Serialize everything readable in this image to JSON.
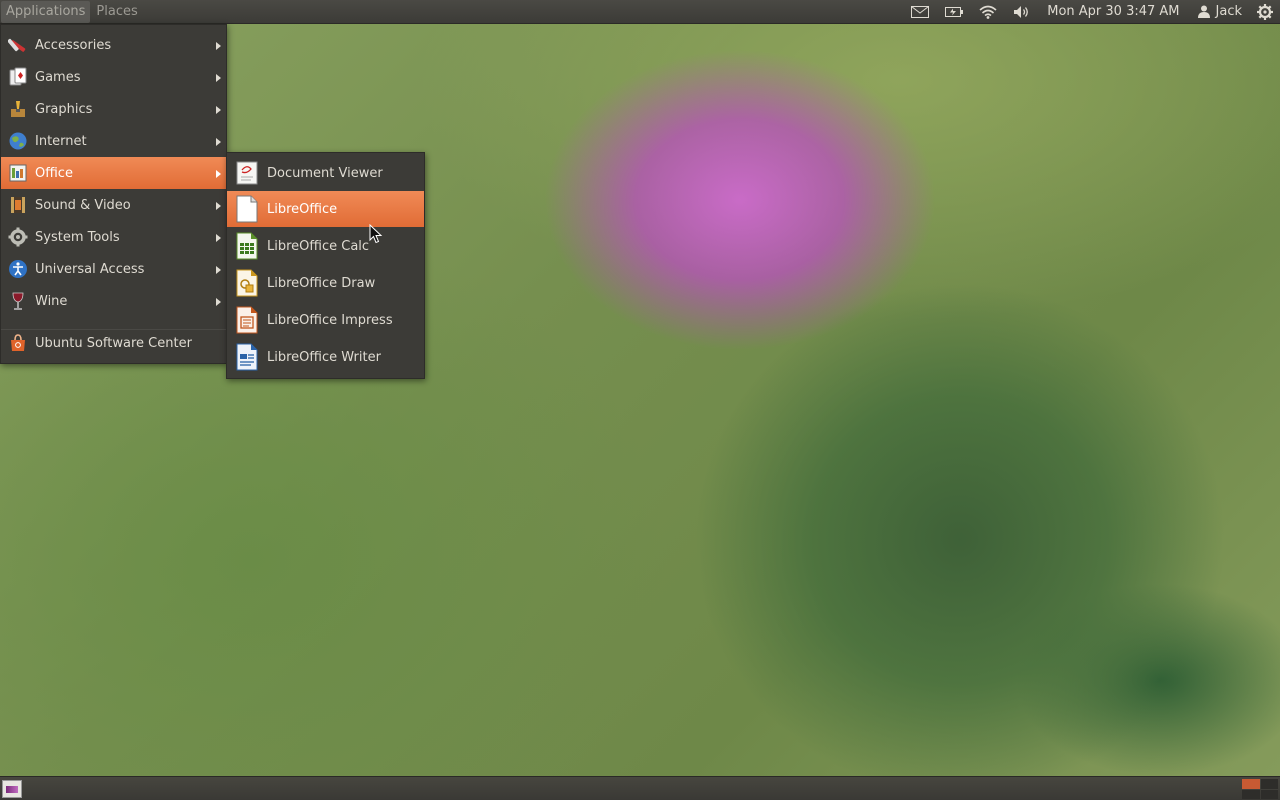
{
  "top_panel": {
    "menus": [
      {
        "label": "Applications",
        "active": true
      },
      {
        "label": "Places",
        "active": false
      }
    ],
    "tray_icons": [
      "mail-icon",
      "battery-icon",
      "wifi-icon",
      "volume-icon"
    ],
    "clock": "Mon Apr 30  3:47 AM",
    "user": "Jack",
    "session_icon": "gear-icon"
  },
  "applications_menu": {
    "items": [
      {
        "label": "Accessories",
        "icon": "accessories-icon",
        "has_submenu": true
      },
      {
        "label": "Games",
        "icon": "games-icon",
        "has_submenu": true
      },
      {
        "label": "Graphics",
        "icon": "graphics-icon",
        "has_submenu": true
      },
      {
        "label": "Internet",
        "icon": "internet-icon",
        "has_submenu": true
      },
      {
        "label": "Office",
        "icon": "office-icon",
        "has_submenu": true,
        "active": true
      },
      {
        "label": "Sound & Video",
        "icon": "sound-video-icon",
        "has_submenu": true
      },
      {
        "label": "System Tools",
        "icon": "system-tools-icon",
        "has_submenu": true
      },
      {
        "label": "Universal Access",
        "icon": "universal-access-icon",
        "has_submenu": true
      },
      {
        "label": "Wine",
        "icon": "wine-icon",
        "has_submenu": true
      }
    ],
    "software_center": {
      "label": "Ubuntu Software Center",
      "icon": "software-center-icon"
    }
  },
  "office_submenu": {
    "items": [
      {
        "label": "Document Viewer",
        "icon": "document-viewer-icon"
      },
      {
        "label": "LibreOffice",
        "icon": "libreoffice-icon",
        "active": true
      },
      {
        "label": "LibreOffice Calc",
        "icon": "libreoffice-calc-icon"
      },
      {
        "label": "LibreOffice Draw",
        "icon": "libreoffice-draw-icon"
      },
      {
        "label": "LibreOffice Impress",
        "icon": "libreoffice-impress-icon"
      },
      {
        "label": "LibreOffice Writer",
        "icon": "libreoffice-writer-icon"
      }
    ]
  },
  "bottom_panel": {
    "show_desktop_icon": "show-desktop-icon",
    "workspaces": 4,
    "current_workspace": 1
  },
  "colors": {
    "panel_bg": "#3c3b37",
    "highlight": "#e9763f",
    "text": "#dfdbd2"
  }
}
